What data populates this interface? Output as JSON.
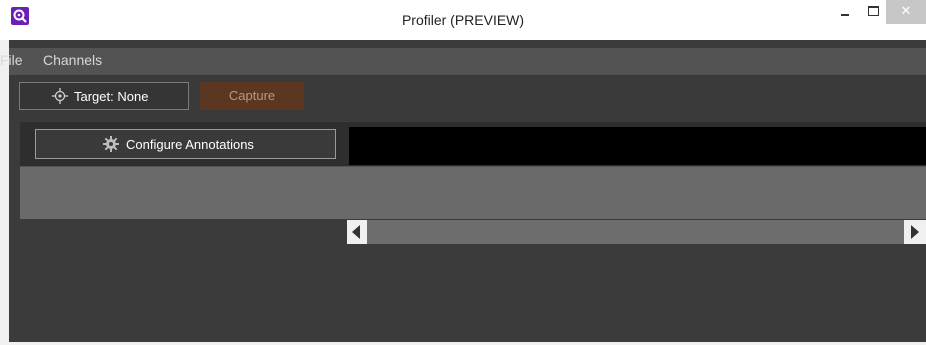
{
  "window": {
    "title": "Profiler (PREVIEW)",
    "close_glyph": "✕",
    "app_icon": "magnifier-icon",
    "accent_color": "#6a1fb5"
  },
  "menu": {
    "items": [
      {
        "label": "File"
      },
      {
        "label": "Channels"
      }
    ]
  },
  "toolbar": {
    "target_label": "Target: None",
    "target_icon": "crosshair-icon",
    "capture_label": "Capture",
    "capture_color": "#5b3722"
  },
  "annotations": {
    "configure_label": "Configure Annotations",
    "configure_icon": "gear-icon"
  },
  "scrollbar": {
    "left_icon": "arrow-left-icon",
    "right_icon": "arrow-right-icon"
  }
}
